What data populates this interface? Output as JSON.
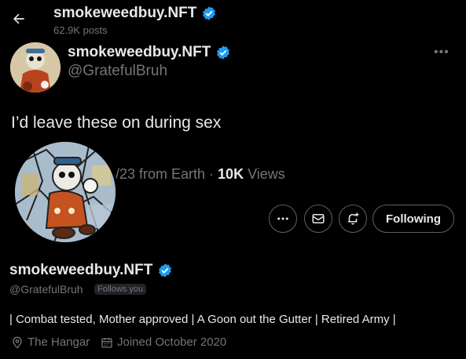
{
  "header": {
    "name": "smokeweedbuy.NFT",
    "posts": "62.9K posts"
  },
  "tweet": {
    "name": "smokeweedbuy.NFT",
    "handle": "@GratefulBruh",
    "more": "•••",
    "text": "I’d leave these on during sex",
    "meta_partial_date": "/23 from Earth · ",
    "views_count": "10K",
    "views_label": " Views"
  },
  "profile": {
    "follow_label": "Following",
    "name": "smokeweedbuy.NFT",
    "handle": "@GratefulBruh",
    "follows_you": "Follows you",
    "bio": "| Combat tested, Mother approved | A Goon out the Gutter | Retired Army |",
    "location": "The Hangar",
    "joined": "Joined October 2020"
  },
  "colors": {
    "background": "#000000",
    "text": "#e7e9ea",
    "muted": "#71767b",
    "verified": "#1d9bf0",
    "border": "#536471"
  }
}
